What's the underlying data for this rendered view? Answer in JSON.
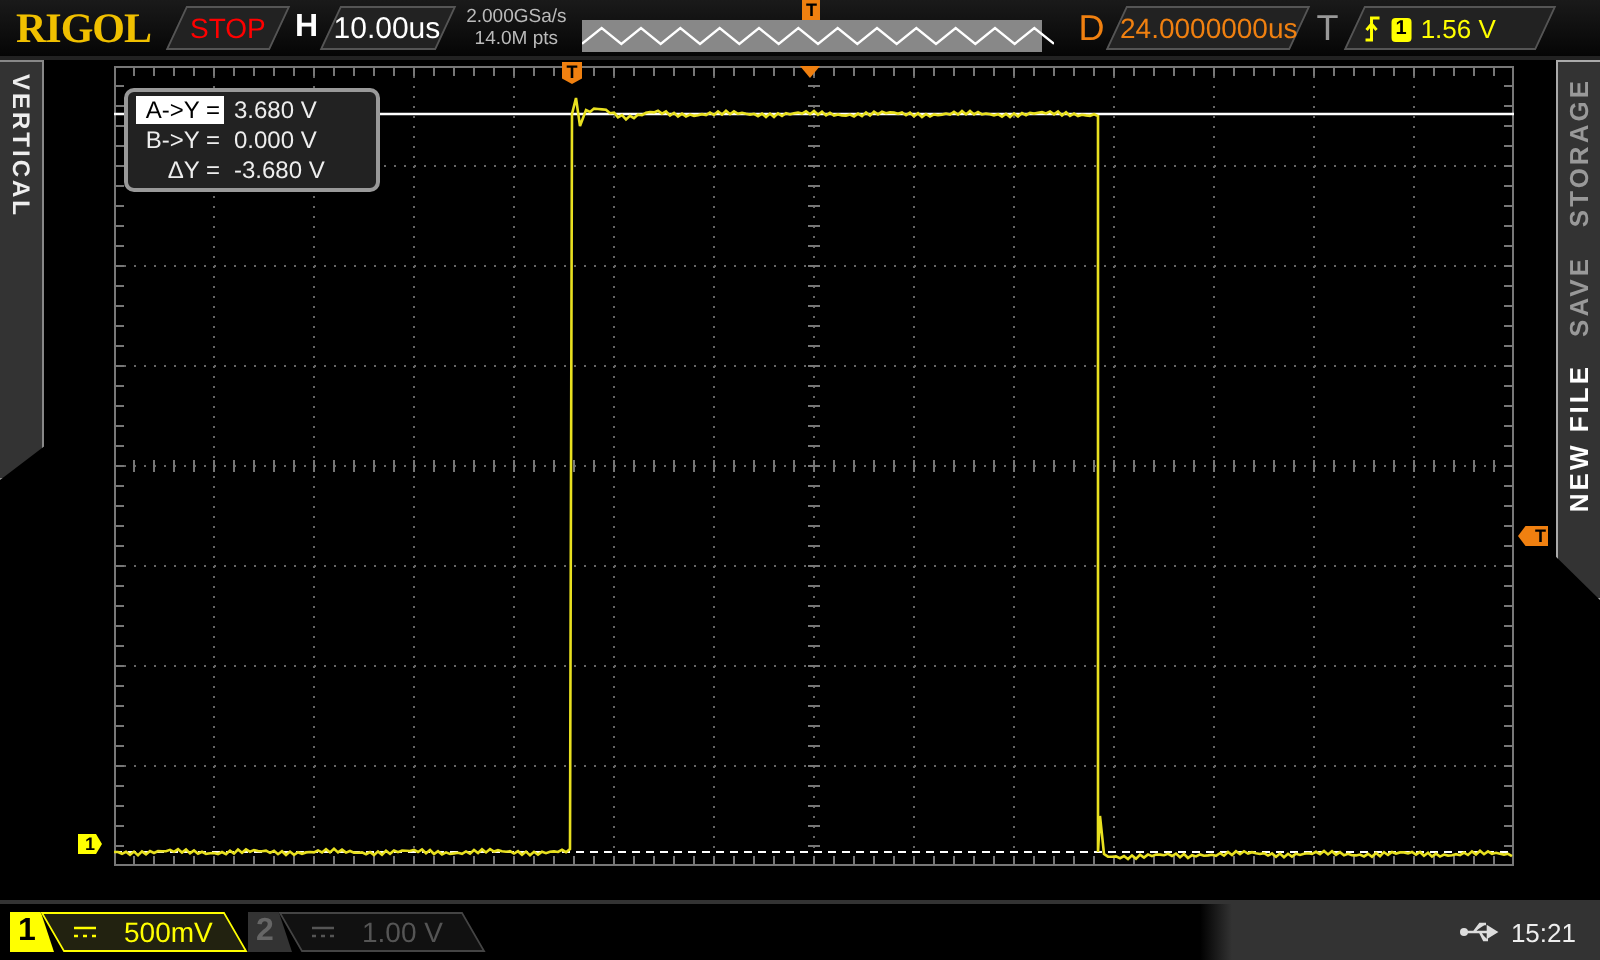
{
  "brand": "RIGOL",
  "run_state": {
    "label": "STOP",
    "kind": "stop"
  },
  "horizontal": {
    "label": "H",
    "timebase": "10.00us"
  },
  "acquisition": {
    "sample_rate": "2.000GSa/s",
    "memory_depth": "14.0M pts"
  },
  "overview_marker": "T",
  "delay": {
    "label": "D",
    "value": "24.0000000us"
  },
  "trigger": {
    "label": "T",
    "source": "1",
    "level": "1.56 V"
  },
  "left_tab": "VERTICAL",
  "cursor_readout": [
    {
      "label": "A->Y =",
      "value": "3.680 V",
      "selected": true
    },
    {
      "label": "B->Y =",
      "value": "0.000 V",
      "selected": false
    },
    {
      "label": "ΔY =",
      "value": "-3.680 V",
      "selected": false
    }
  ],
  "markers": {
    "trigger_position": "T",
    "trigger_level": "T",
    "channel": "1"
  },
  "right_menu": [
    "STORAGE",
    "SAVE",
    "NEW FILE"
  ],
  "channels": [
    {
      "number": "1",
      "scale": "500mV",
      "on": true
    },
    {
      "number": "2",
      "scale": "1.00 V",
      "on": false
    }
  ],
  "status": {
    "time": "15:21"
  }
}
